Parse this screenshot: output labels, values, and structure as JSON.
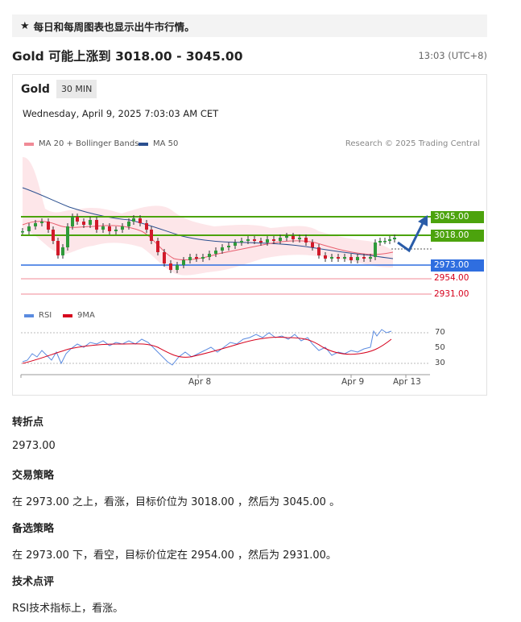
{
  "banner": {
    "text": "每日和每周图表也显示出牛市行情。"
  },
  "headline": "Gold 可能上涨到 3018.00 - 3045.00",
  "time": "13:03 (UTC+8)",
  "chart": {
    "instrument": "Gold",
    "timeframe": "30 MIN",
    "date": "Wednesday, April 9, 2025 7:03:03 AM CET",
    "legend": {
      "ma20": "MA 20 + Bollinger Bands",
      "ma50": "MA 50"
    },
    "copyright": "Research © 2025 Trading Central",
    "rsi_legend": {
      "rsi": "RSI",
      "ma": "9MA"
    },
    "rsi_ticks": [
      "70",
      "50",
      "30"
    ],
    "x_ticks": [
      "Apr 8",
      "Apr 9",
      "Apr 13"
    ],
    "levels": {
      "r2": "3045.00",
      "r1": "3018.00",
      "pivot": "2973.00",
      "s1": "2954.00",
      "s2": "2931.00"
    },
    "colors": {
      "green": "#4ca30d",
      "blue": "#2f6ee0",
      "red": "#d6001c",
      "ma50": "#2a4f8f",
      "bb": "#f4a8b4"
    }
  },
  "sections": {
    "pivot_h": "转折点",
    "pivot_v": "2973.00",
    "strategy_h": "交易策略",
    "strategy_v": "在 2973.00 之上，看涨，目标价位为 3018.00 ，然后为 3045.00 。",
    "alt_h": "备选策略",
    "alt_v": "在 2973.00 下，看空，目标价位定在 2954.00 ，然后为 2931.00。",
    "comment_h": "技术点评",
    "comment_v": "RSI技术指标上，看涨。"
  }
}
